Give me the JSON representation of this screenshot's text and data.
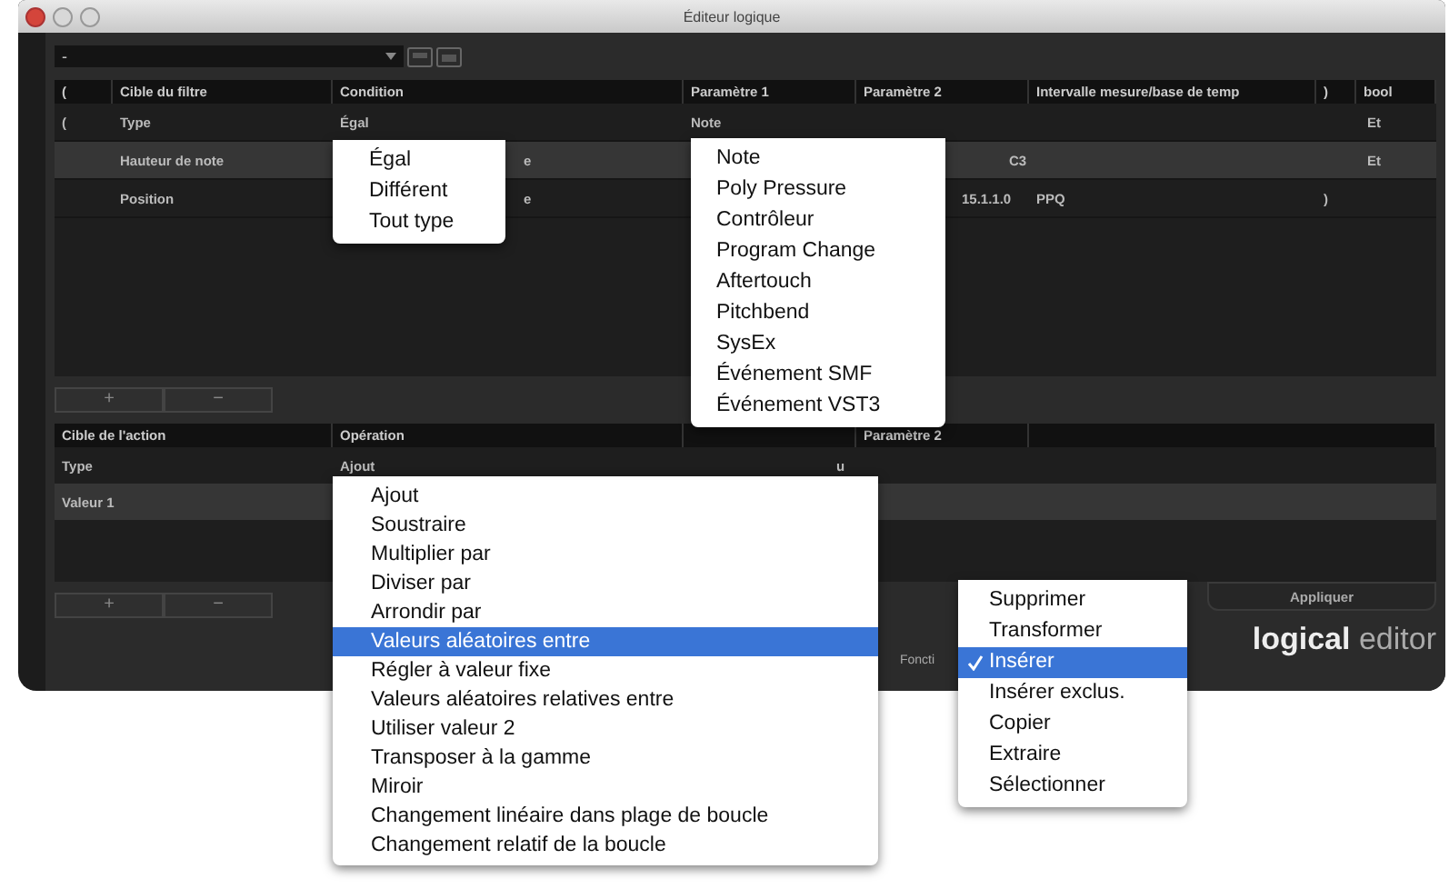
{
  "window": {
    "title": "Éditeur logique"
  },
  "toolbar": {
    "preset": "-"
  },
  "filter_table": {
    "columns": [
      "(",
      "Cible du filtre",
      "Condition",
      "Paramètre 1",
      "Paramètre 2",
      "Intervalle mesure/base de temp",
      ")",
      "bool"
    ],
    "rows": [
      {
        "selected": false,
        "cells": [
          "(",
          "Type",
          "Égal",
          "Note",
          "",
          "",
          "",
          "Et"
        ]
      },
      {
        "selected": true,
        "cells": [
          "",
          "Hauteur de note",
          "e",
          "",
          "C3",
          "",
          "",
          "Et"
        ]
      },
      {
        "selected": false,
        "cells": [
          "",
          "Position",
          "e",
          "",
          "15.1.1.0",
          "PPQ",
          ")",
          ""
        ]
      }
    ]
  },
  "filter_buttons": [
    "+",
    "−"
  ],
  "action_table": {
    "columns": [
      "Cible de l'action",
      "Opération",
      "",
      "Paramètre 2",
      ""
    ],
    "rows": [
      {
        "selected": false,
        "cells": [
          "Type",
          "Ajout",
          "u",
          "",
          ""
        ]
      },
      {
        "selected": true,
        "cells": [
          "Valeur 1",
          "",
          "",
          "",
          ""
        ]
      }
    ]
  },
  "action_buttons": [
    "+",
    "−"
  ],
  "apply_button": "Appliquer",
  "function_label": "Foncti",
  "logo": {
    "strong": "logical",
    "light": "editor"
  },
  "menus": [
    {
      "items": [
        {
          "label": "Égal",
          "selected": false
        },
        {
          "label": "Différent",
          "selected": false
        },
        {
          "label": "Tout type",
          "selected": false
        }
      ]
    },
    {
      "items": [
        {
          "label": "Note",
          "selected": false
        },
        {
          "label": "Poly Pressure",
          "selected": false
        },
        {
          "label": "Contrôleur",
          "selected": false
        },
        {
          "label": "Program Change",
          "selected": false
        },
        {
          "label": "Aftertouch",
          "selected": false
        },
        {
          "label": "Pitchbend",
          "selected": false
        },
        {
          "label": "SysEx",
          "selected": false
        },
        {
          "label": "Événement SMF",
          "selected": false
        },
        {
          "label": "Événement VST3",
          "selected": false
        }
      ]
    },
    {
      "items": [
        {
          "label": "Ajout",
          "selected": false
        },
        {
          "label": "Soustraire",
          "selected": false
        },
        {
          "label": "Multiplier par",
          "selected": false
        },
        {
          "label": "Diviser par",
          "selected": false
        },
        {
          "label": "Arrondir par",
          "selected": false
        },
        {
          "label": "Valeurs aléatoires entre",
          "selected": true
        },
        {
          "label": "Régler à valeur fixe",
          "selected": false
        },
        {
          "label": "Valeurs aléatoires relatives entre",
          "selected": false
        },
        {
          "label": "Utiliser valeur 2",
          "selected": false
        },
        {
          "label": "Transposer à la gamme",
          "selected": false
        },
        {
          "label": "Miroir",
          "selected": false
        },
        {
          "label": "Changement linéaire dans plage de boucle",
          "selected": false
        },
        {
          "label": "Changement relatif de la boucle",
          "selected": false
        }
      ]
    },
    {
      "items": [
        {
          "label": "Supprimer",
          "selected": false,
          "checked": false
        },
        {
          "label": "Transformer",
          "selected": false,
          "checked": false
        },
        {
          "label": "Insérer",
          "selected": true,
          "checked": true
        },
        {
          "label": "Insérer exclus.",
          "selected": false,
          "checked": false
        },
        {
          "label": "Copier",
          "selected": false,
          "checked": false
        },
        {
          "label": "Extraire",
          "selected": false,
          "checked": false
        },
        {
          "label": "Sélectionner",
          "selected": false,
          "checked": false
        }
      ]
    }
  ]
}
